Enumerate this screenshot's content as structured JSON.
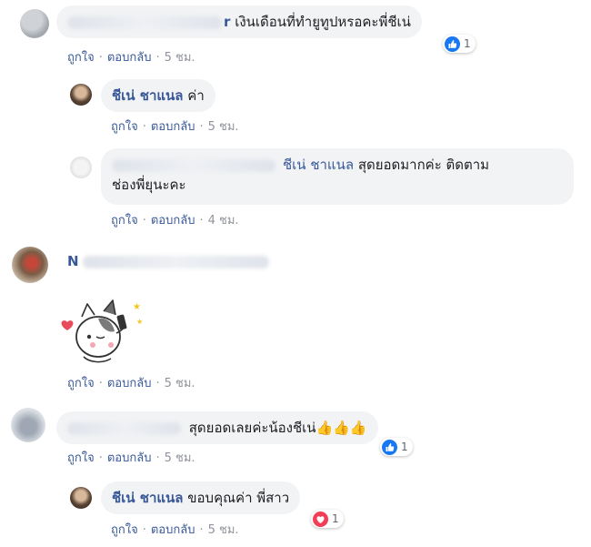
{
  "colors": {
    "link": "#385898",
    "bubble": "#f2f3f5",
    "meta": "#90949c",
    "like_blue": "#1877f2",
    "love_red": "#f33e58"
  },
  "actions": {
    "like": "ถูกใจ",
    "reply": "ตอบกลับ",
    "sep": "·"
  },
  "comments": [
    {
      "name_visible": "r",
      "text": "เงินเดือนที่ทำยูทูปหรอคะพี่ชีเน่",
      "time": "5 ชม.",
      "reaction": {
        "icon": "like-icon",
        "count": "1"
      }
    },
    {
      "name": "ชีเน่ ชาแนล",
      "text": "ค่า",
      "time": "5 ชม."
    },
    {
      "name_visible": "",
      "mention": "ชีเน่ ชาแนล",
      "text_line1": "สุดยอดมากค่ะ ติดตาม",
      "text_line2": "ช่องพี่ยุนะคะ",
      "time": "4 ชม."
    },
    {
      "name_visible": "N",
      "sticker": "cat-selfie-sticker",
      "time": "5 ชม."
    },
    {
      "name_visible": "",
      "text": "สุดยอดเลยค่ะน้องชีเน่",
      "emoji": "👍👍👍",
      "time": "5 ชม.",
      "reaction": {
        "icon": "like-icon",
        "count": "1"
      }
    },
    {
      "name": "ชีเน่ ชาแนล",
      "text": "ขอบคุณค่า พี่สาว",
      "time": "5 ชม.",
      "reaction": {
        "icon": "heart-icon",
        "count": "1"
      }
    }
  ]
}
